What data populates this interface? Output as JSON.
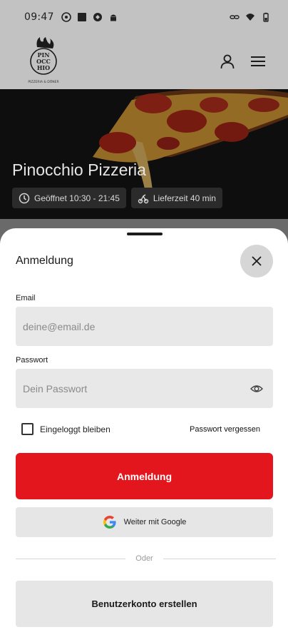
{
  "status_bar": {
    "time": "09:47",
    "left_icons": [
      "steam-icon",
      "square-icon",
      "sync-icon",
      "android-icon"
    ],
    "right_icons": [
      "link-icon",
      "wifi-icon",
      "battery-icon"
    ]
  },
  "app_bar": {
    "logo_lines": [
      "PIN",
      "OCC",
      "HIO"
    ],
    "logo_tagline": "PIZZERIA & DÖNER",
    "icons": [
      "user-icon",
      "menu-icon"
    ]
  },
  "hero": {
    "title": "Pinocchio Pizzeria",
    "opening_hours": "Geöffnet 10:30 - 21:45",
    "delivery_time": "Lieferzeit 40 min",
    "icons": [
      "clock-icon",
      "delivery-icon"
    ]
  },
  "login_sheet": {
    "title": "Anmeldung",
    "email_label": "Email",
    "email_placeholder": "deine@email.de",
    "password_label": "Passwort",
    "password_placeholder": "Dein Passwort",
    "remember_label": "Eingeloggt bleiben",
    "forgot_label": "Passwort vergessen",
    "login_button": "Anmeldung",
    "google_button": "Weiter mit Google",
    "divider_text": "Oder",
    "register_button": "Benutzerkonto erstellen"
  },
  "colors": {
    "accent": "#e3161d",
    "overlay": "#6a6a6a",
    "field_background": "#e8e8e8"
  }
}
